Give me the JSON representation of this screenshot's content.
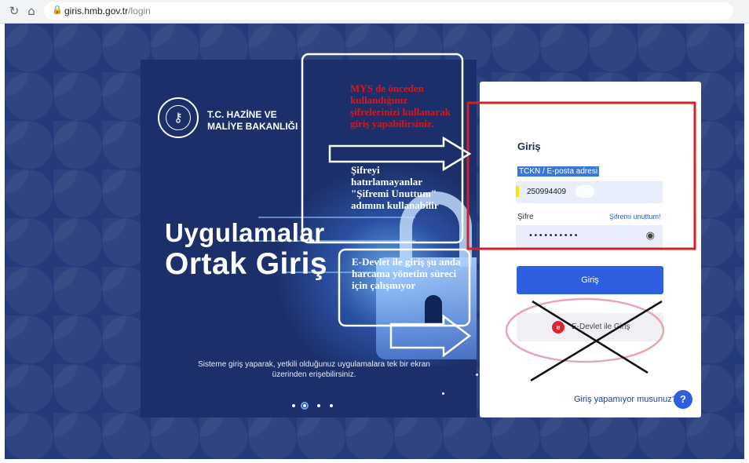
{
  "browser": {
    "back_icon": "reload-icon",
    "home_icon": "home-icon",
    "lock_icon": "lock-icon",
    "url_host": "giris.hmb.gov.tr",
    "url_path": "/login"
  },
  "hero": {
    "ministry_name": "T.C. HAZİNE VE\nMALİYE BAKANLIĞI",
    "title_line1": "Uygulamalar",
    "title_line2": "Ortak Giriş",
    "subtitle": "Sisteme giriş yaparak, yetkili olduğunuz uygulamalara tek bir ekran üzerinden erişebilirsiniz."
  },
  "login": {
    "title": "Giriş",
    "id_label": "TCKN / E-posta adresi",
    "id_value": "250994409",
    "password_label": "Şifre",
    "forgot_link": "Şifremi unuttum!",
    "password_value": "••••••••••",
    "submit_label": "Giriş",
    "edevlet_label": "E-Devlet ile Giriş",
    "edevlet_icon_text": "e",
    "help_link": "Giriş yapamıyor musunuz?",
    "help_icon_text": "?"
  },
  "annotations": {
    "red_note": "MYS de önceden kullandığınız şifrelerinizi kullanarak giriş yapabilirsiniz.",
    "forgot_note": "Şifreyi hatırlamayanlar \"Şifremi Unuttum\" adımını kullanabilir",
    "edevlet_note": "E-Devlet ile giriş şu anda harcama yönetim süreci için çalışmıyor"
  },
  "colors": {
    "page_bg": "#243a7a",
    "hero_bg": "#1c2f6a",
    "primary": "#2e5fe0",
    "annotation_red": "#e11414"
  }
}
